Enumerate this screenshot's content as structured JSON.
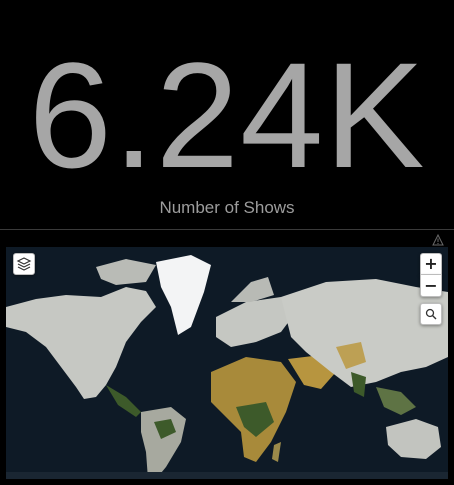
{
  "kpi": {
    "value": "6.24K",
    "label": "Number of Shows"
  },
  "map": {
    "icons": {
      "warning": "warning-triangle-icon",
      "layers": "layers-icon",
      "zoom_in": "plus-icon",
      "zoom_out": "minus-icon",
      "search": "search-icon"
    },
    "zoom_in_label": "+",
    "zoom_out_label": "−",
    "colors": {
      "ocean": "#0e1a26",
      "land": "#c9cbc6",
      "ice": "#f2f4f5",
      "desert": "#a88a3a",
      "forest": "#3d5a2a"
    }
  }
}
